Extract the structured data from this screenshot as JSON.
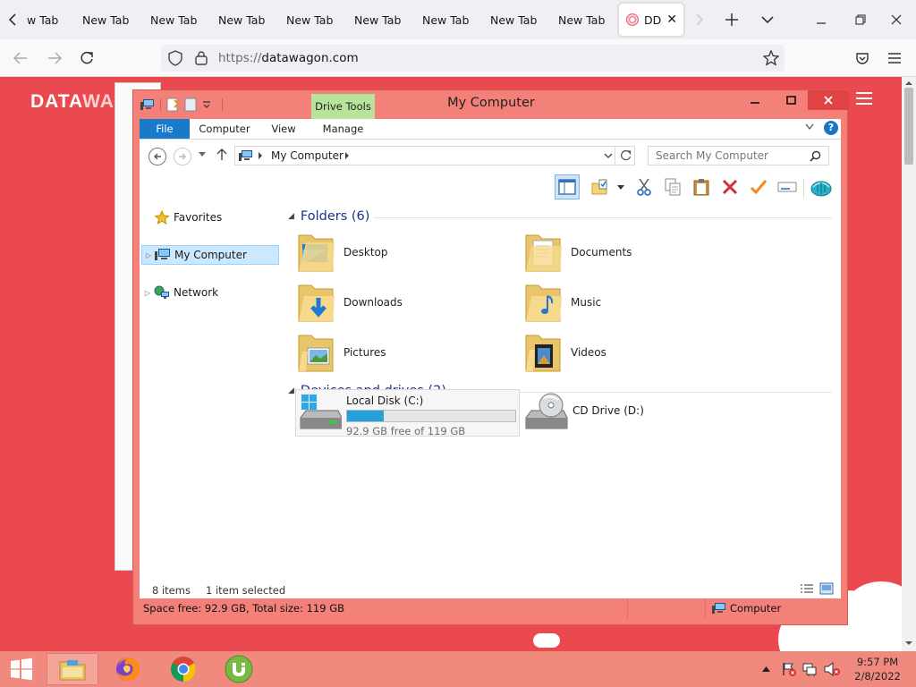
{
  "browser": {
    "tabs": [
      "w Tab",
      "New Tab",
      "New Tab",
      "New Tab",
      "New Tab",
      "New Tab",
      "New Tab",
      "New Tab",
      "New Tab"
    ],
    "active_tab": "DD",
    "url_scheme": "https://",
    "url_host": "datawagon.com"
  },
  "page": {
    "logo_bold": "DATA",
    "logo_light": "WA"
  },
  "explorer": {
    "title": "My Computer",
    "contextual_tab": "Drive Tools",
    "ribbon_tabs": [
      "File",
      "Computer",
      "View",
      "Manage"
    ],
    "address": "My Computer",
    "search_placeholder": "Search My Computer",
    "nav": [
      "Favorites",
      "My Computer",
      "Network"
    ],
    "folders_header": "Folders (6)",
    "folders": [
      "Desktop",
      "Documents",
      "Downloads",
      "Music",
      "Pictures",
      "Videos"
    ],
    "drives_header": "Devices and drives (2)",
    "drives": [
      {
        "name": "Local Disk (C:)",
        "free": "92.9 GB free of 119 GB",
        "used_fraction": 0.22
      },
      {
        "name": "CD Drive (D:)"
      }
    ],
    "status_items": "8 items",
    "status_selected": "1 item selected",
    "space_info": "Space free: 92.9 GB, Total size: 119 GB",
    "location": "Computer"
  },
  "taskbar": {
    "time": "9:57 PM",
    "date": "2/8/2022"
  },
  "colors": {
    "page_bg": "#ea4a4f",
    "window_frame": "#f38079",
    "file_tab": "#1979ca",
    "drive_fill": "#26a0da",
    "contextual_tab": "#b8e39b"
  }
}
